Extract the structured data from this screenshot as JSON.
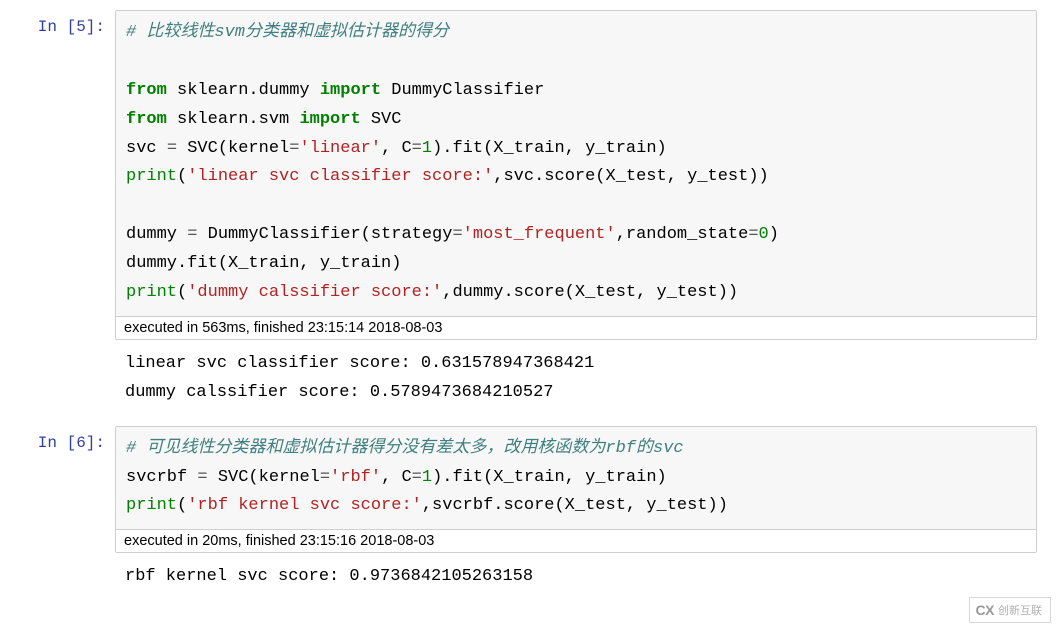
{
  "cells": [
    {
      "prompt": "In  [5]:",
      "code": {
        "t00": "# 比较线性svm分类器和虚拟估计器的得分",
        "t01_from": "from",
        "t01_mod": " sklearn.dummy ",
        "t01_imp": "import",
        "t01_cls": " DummyClassifier",
        "t02_from": "from",
        "t02_mod": " sklearn.svm ",
        "t02_imp": "import",
        "t02_cls": " SVC",
        "t03_lhs": "svc ",
        "t03_eq": "=",
        "t03_a": " SVC(kernel",
        "t03_b": "=",
        "t03_str": "'linear'",
        "t03_c": ", C",
        "t03_d": "=",
        "t03_num": "1",
        "t03_e": ").fit(X_train, y_train)",
        "t04_pr": "print",
        "t04_a": "(",
        "t04_str": "'linear svc classifier score:'",
        "t04_b": ",svc.score(X_test, y_test))",
        "t05_lhs": "dummy ",
        "t05_eq": "=",
        "t05_a": " DummyClassifier(strategy",
        "t05_b": "=",
        "t05_str": "'most_frequent'",
        "t05_c": ",random_state",
        "t05_d": "=",
        "t05_num": "0",
        "t05_e": ")",
        "t06": "dummy.fit(X_train, y_train)",
        "t07_pr": "print",
        "t07_a": "(",
        "t07_str": "'dummy calssifier score:'",
        "t07_b": ",dummy.score(X_test, y_test))"
      },
      "exec": "executed in 563ms, finished 23:15:14 2018-08-03",
      "output": "linear svc classifier score: 0.631578947368421\ndummy calssifier score: 0.5789473684210527"
    },
    {
      "prompt": "In  [6]:",
      "code": {
        "t00": "# 可见线性分类器和虚拟估计器得分没有差太多，改用核函数为rbf的svc",
        "t01_lhs": "svcrbf ",
        "t01_eq": "=",
        "t01_a": " SVC(kernel",
        "t01_b": "=",
        "t01_str": "'rbf'",
        "t01_c": ", C",
        "t01_d": "=",
        "t01_num": "1",
        "t01_e": ").fit(X_train, y_train)",
        "t02_pr": "print",
        "t02_a": "(",
        "t02_str": "'rbf kernel svc score:'",
        "t02_b": ",svcrbf.score(X_test, y_test))"
      },
      "exec": "executed in 20ms, finished 23:15:16 2018-08-03",
      "output": "rbf kernel svc score: 0.9736842105263158"
    }
  ],
  "watermark": {
    "logo": "CX",
    "text": "创新互联"
  }
}
